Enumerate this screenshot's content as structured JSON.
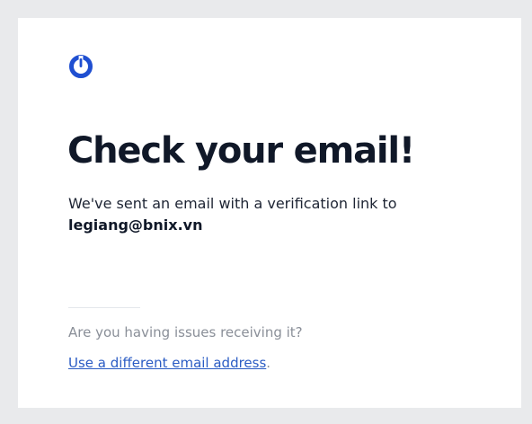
{
  "brand": {
    "logo_icon": "power-icon",
    "accent_color": "#1f4fd1"
  },
  "content": {
    "title": "Check your email!",
    "message": "We've sent an email with a verification link to",
    "email": "legiang@bnix.vn",
    "issues_text": "Are you having issues receiving it?",
    "alt_link_label": "Use a different email address",
    "alt_link_suffix": "."
  }
}
